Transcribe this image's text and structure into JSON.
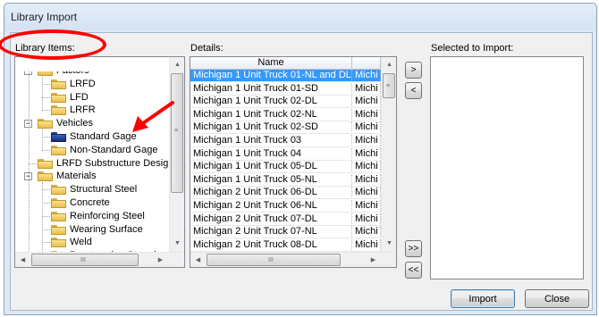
{
  "window": {
    "title": "Library Import"
  },
  "labels": {
    "library_items": "Library Items:",
    "details": "Details:",
    "selected_to_import": "Selected to Import:"
  },
  "tree": [
    {
      "label": "Factors",
      "level": 1,
      "type": "group"
    },
    {
      "label": "LRFD",
      "level": 2,
      "type": "leaf"
    },
    {
      "label": "LFD",
      "level": 2,
      "type": "leaf"
    },
    {
      "label": "LRFR",
      "level": 2,
      "type": "leaf"
    },
    {
      "label": "Vehicles",
      "level": 1,
      "type": "group"
    },
    {
      "label": "Standard Gage",
      "level": 2,
      "type": "leaf",
      "selected": true
    },
    {
      "label": "Non-Standard Gage",
      "level": 2,
      "type": "leaf"
    },
    {
      "label": "LRFD Substructure Design",
      "level": 1,
      "type": "leaf"
    },
    {
      "label": "Materials",
      "level": 1,
      "type": "group"
    },
    {
      "label": "Structural Steel",
      "level": 2,
      "type": "leaf"
    },
    {
      "label": "Concrete",
      "level": 2,
      "type": "leaf"
    },
    {
      "label": "Reinforcing Steel",
      "level": 2,
      "type": "leaf"
    },
    {
      "label": "Wearing Surface",
      "level": 2,
      "type": "leaf"
    },
    {
      "label": "Weld",
      "level": 2,
      "type": "leaf"
    },
    {
      "label": "Prestressing Strand",
      "level": 2,
      "type": "leaf"
    }
  ],
  "details": {
    "columns": [
      "Name",
      ""
    ],
    "rows": [
      {
        "name": "Michigan 1 Unit Truck 01-NL and DL",
        "col2": "Michi",
        "selected": true
      },
      {
        "name": "Michigan 1 Unit Truck 01-SD",
        "col2": "Michi"
      },
      {
        "name": "Michigan 1 Unit Truck 02-DL",
        "col2": "Michi"
      },
      {
        "name": "Michigan 1 Unit Truck 02-NL",
        "col2": "Michi"
      },
      {
        "name": "Michigan 1 Unit Truck 02-SD",
        "col2": "Michi"
      },
      {
        "name": "Michigan 1 Unit Truck 03",
        "col2": "Michi"
      },
      {
        "name": "Michigan 1 Unit Truck 04",
        "col2": "Michi"
      },
      {
        "name": "Michigan 1 Unit Truck 05-DL",
        "col2": "Michi"
      },
      {
        "name": "Michigan 1 Unit Truck 05-NL",
        "col2": "Michi"
      },
      {
        "name": "Michigan 2 Unit Truck 06-DL",
        "col2": "Michi"
      },
      {
        "name": "Michigan 2 Unit Truck 06-NL",
        "col2": "Michi"
      },
      {
        "name": "Michigan 2 Unit Truck 07-DL",
        "col2": "Michi"
      },
      {
        "name": "Michigan 2 Unit Truck 07-NL",
        "col2": "Michi"
      },
      {
        "name": "Michigan 2 Unit Truck 08-DL",
        "col2": "Michi"
      }
    ]
  },
  "transfer_buttons": {
    "add": ">",
    "remove": "<",
    "add_all": ">>",
    "remove_all": "<<"
  },
  "scroll": {
    "up": "▲",
    "down": "▼",
    "left": "◀",
    "right": "▶",
    "grip_h": "III",
    "grip_v": "≡"
  },
  "buttons": {
    "import": "Import",
    "close": "Close"
  },
  "colors": {
    "annotation": "#ff0000",
    "selection": "#3399ff"
  }
}
